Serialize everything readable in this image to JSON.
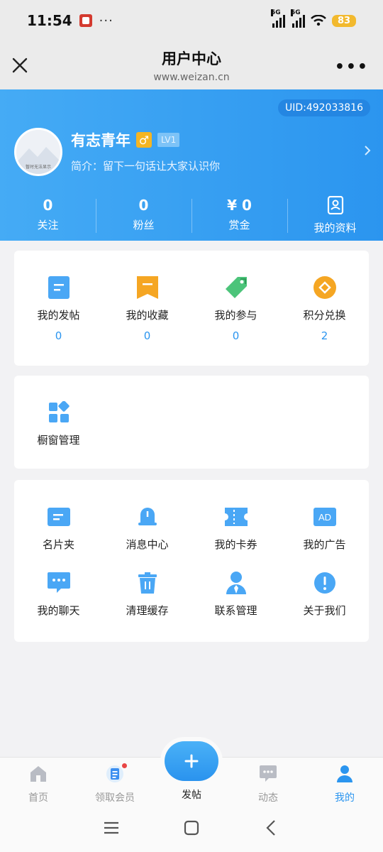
{
  "status": {
    "time": "11:54",
    "app_icon": "app-notification-icon",
    "more": "···",
    "signal1": "5G",
    "signal2": "5G",
    "battery": "83"
  },
  "nav": {
    "title": "用户中心",
    "subtitle": "www.weizan.cn",
    "close_icon": "close-icon",
    "more_icon": "more-icon"
  },
  "profile": {
    "uid": "UID:492033816",
    "name": "有志青年",
    "gender_symbol": "♂",
    "level": "LV1",
    "bio": "简介：留下一句话让大家认识你",
    "avatar_text": "暂时无法显示"
  },
  "stats": [
    {
      "value": "0",
      "label": "关注"
    },
    {
      "value": "0",
      "label": "粉丝"
    },
    {
      "value": "¥ 0",
      "label": "赏金"
    },
    {
      "label": "我的资料",
      "icon": "profile-card-icon"
    }
  ],
  "main_menu": [
    {
      "label": "我的发帖",
      "count": "0",
      "icon": "post-doc-icon"
    },
    {
      "label": "我的收藏",
      "count": "0",
      "icon": "bookmark-icon"
    },
    {
      "label": "我的参与",
      "count": "0",
      "icon": "tag-icon"
    },
    {
      "label": "积分兑换",
      "count": "2",
      "icon": "points-coin-icon"
    }
  ],
  "shop": {
    "label": "橱窗管理",
    "icon": "showcase-grid-icon"
  },
  "tools": [
    {
      "label": "名片夹",
      "icon": "card-holder-icon"
    },
    {
      "label": "消息中心",
      "icon": "bell-icon"
    },
    {
      "label": "我的卡券",
      "icon": "ticket-icon"
    },
    {
      "label": "我的广告",
      "icon": "ad-icon",
      "icon_text": "AD"
    },
    {
      "label": "我的聊天",
      "icon": "chat-icon"
    },
    {
      "label": "清理缓存",
      "icon": "trash-icon"
    },
    {
      "label": "联系管理",
      "icon": "contact-admin-icon"
    },
    {
      "label": "关于我们",
      "icon": "about-icon"
    }
  ],
  "tabbar": [
    {
      "label": "首页",
      "icon": "home-icon"
    },
    {
      "label": "领取会员",
      "icon": "membership-icon"
    },
    {
      "label": "发帖",
      "icon": "plus-icon"
    },
    {
      "label": "动态",
      "icon": "feed-chat-icon"
    },
    {
      "label": "我的",
      "icon": "user-icon"
    }
  ],
  "colors": {
    "accent": "#2b95ef",
    "header_gradient_start": "#45abf5",
    "gold": "#f4b522",
    "badge": "#e84545"
  }
}
